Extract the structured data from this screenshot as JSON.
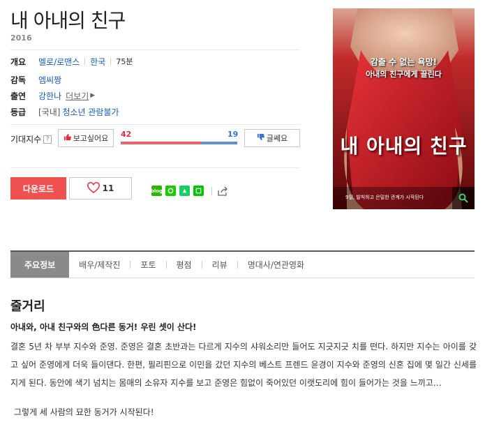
{
  "movie": {
    "title": "내 아내의 친구",
    "year": "2016"
  },
  "info": {
    "overview_label": "개요",
    "genre": "멜로/로맨스",
    "country": "한국",
    "runtime": "75분",
    "director_label": "감독",
    "director": "엠씨짱",
    "cast_label": "출연",
    "cast": "강한나",
    "more_label": "더보기",
    "rating_label": "등급",
    "rating_prefix": "[국내]",
    "rating": "청소년 관람불가"
  },
  "expectation": {
    "label": "기대지수",
    "help": "?",
    "want_label": "보고싶어요",
    "want_count": "42",
    "meh_label": "글쎄요",
    "meh_count": "19",
    "want_fraction": 0.6875
  },
  "actions": {
    "download_label": "다운로드",
    "like_count": "11"
  },
  "share": {
    "icons": [
      "blog-icon",
      "band-icon",
      "kakao-icon",
      "line-icon",
      "share-icon"
    ]
  },
  "poster": {
    "tagline1": "감출 수 없는 욕망!",
    "tagline2": "아내의 친구에게 끌린다",
    "title": "내 아내의 친구",
    "bottom": "9일, 발칙하고 은밀한 관계가 시작된다"
  },
  "tabs": [
    {
      "label": "주요정보",
      "active": true
    },
    {
      "label": "배우/제작진",
      "active": false
    },
    {
      "label": "포토",
      "active": false
    },
    {
      "label": "평점",
      "active": false
    },
    {
      "label": "리뷰",
      "active": false
    },
    {
      "label": "명대사/연관영화",
      "active": false
    }
  ],
  "synopsis": {
    "title": "줄거리",
    "headline": "아내와, 아내 친구와의 色다른 동거! 우린 셋이 산다!",
    "body": "결혼 5년 차 부부 지수와 준영. 준영은 결혼 초반과는 다르게 지수의 샤워소리만 들어도 지긋지긋 치를 떤다. 하지만 지수는 아이를 갖고 싶어 준영에게 더욱 들이댄다. 한편, 필리핀으로 이민을 갔던 지수의 베스트 프렌드 윤경이 지수와 준영의 신혼 집에 몇 일간 신세를 지게 된다. 동안에 색기 넘치는 몸매의 소유자 지수를 보고 준영은 힘없이 죽어있던 이랫도리에 힘이 들어가는 것을 느끼고…",
    "ending": "그렇게 세 사람의 묘한 동거가 시작된다!"
  }
}
